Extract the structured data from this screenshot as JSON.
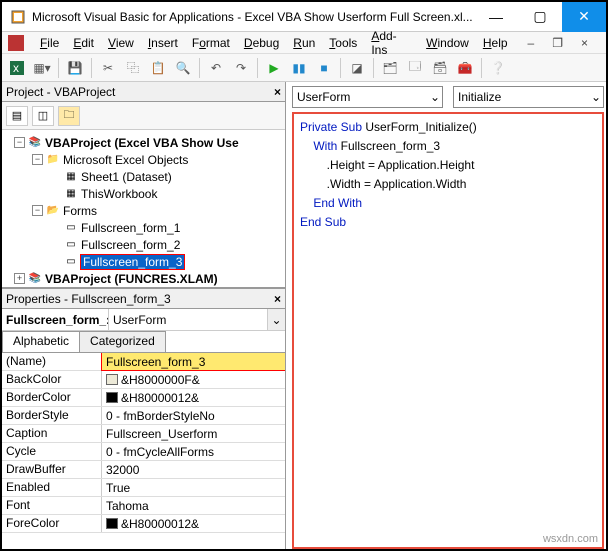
{
  "window": {
    "title": "Microsoft Visual Basic for Applications - Excel VBA Show Userform Full Screen.xl..."
  },
  "menubar": {
    "file": "File",
    "edit": "Edit",
    "view": "View",
    "insert": "Insert",
    "format": "Format",
    "debug": "Debug",
    "run": "Run",
    "tools": "Tools",
    "addins": "Add-Ins",
    "window": "Window",
    "help": "Help"
  },
  "project_panel": {
    "title": "Project - VBAProject",
    "root": "VBAProject (Excel VBA Show Use",
    "excel_objects": "Microsoft Excel Objects",
    "sheet1": "Sheet1 (Dataset)",
    "thiswb": "ThisWorkbook",
    "forms": "Forms",
    "form1": "Fullscreen_form_1",
    "form2": "Fullscreen_form_2",
    "form3": "Fullscreen_form_3",
    "funcres": "VBAProject (FUNCRES.XLAM)"
  },
  "properties_panel": {
    "title": "Properties - Fullscreen_form_3",
    "dd_left": "Fullscreen_form_:",
    "dd_right": "UserForm",
    "tab1": "Alphabetic",
    "tab2": "Categorized",
    "rows": {
      "name_label": "(Name)",
      "name_val": "Fullscreen_form_3",
      "backcolor_label": "BackColor",
      "backcolor_val": "&H8000000F&",
      "bordercolor_label": "BorderColor",
      "bordercolor_val": "&H80000012&",
      "borderstyle_label": "BorderStyle",
      "borderstyle_val": "0 - fmBorderStyleNo",
      "caption_label": "Caption",
      "caption_val": "Fullscreen_Userform",
      "cycle_label": "Cycle",
      "cycle_val": "0 - fmCycleAllForms",
      "drawbuffer_label": "DrawBuffer",
      "drawbuffer_val": "32000",
      "enabled_label": "Enabled",
      "enabled_val": "True",
      "font_label": "Font",
      "font_val": "Tahoma",
      "forecolor_label": "ForeColor",
      "forecolor_val": "&H80000012&"
    }
  },
  "code_pane": {
    "object_dd": "UserForm",
    "proc_dd": "Initialize",
    "line1a": "Private Sub",
    "line1b": " UserForm_Initialize()",
    "line2a": "    With",
    "line2b": " Fullscreen_form_3",
    "line3": "        .Height = Application.Height",
    "line4": "        .Width = Application.Width",
    "line5": "    End With",
    "line6": "End Sub"
  },
  "watermark": "wsxdn.com"
}
